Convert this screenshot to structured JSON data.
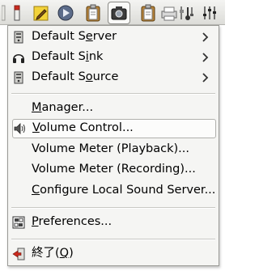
{
  "panel": {
    "icons": [
      "panel-handle-icon",
      "notes-icon",
      "media-player-icon",
      "clipboard-icon",
      "screenshot-icon",
      "clipboard-icon",
      "printer-icon",
      "audio-settings-icon",
      "volume-mixer-icon"
    ]
  },
  "menu": {
    "default_server": {
      "pre": "Default S",
      "key": "e",
      "post": "rver"
    },
    "default_sink": {
      "pre": "Default S",
      "key": "i",
      "post": "nk"
    },
    "default_source": {
      "pre": "Default S",
      "key": "o",
      "post": "urce"
    },
    "manager": {
      "pre": "",
      "key": "M",
      "post": "anager..."
    },
    "volume_control": {
      "pre": "",
      "key": "V",
      "post": "olume Control..."
    },
    "volume_meter_playback": {
      "pre": "Volume Meter (Playback)...",
      "key": "",
      "post": ""
    },
    "volume_meter_recording": {
      "pre": "Volume Meter (Recording)...",
      "key": "",
      "post": ""
    },
    "configure_local": {
      "pre": "",
      "key": "C",
      "post": "onfigure Local Sound Server..."
    },
    "preferences": {
      "pre": "",
      "key": "P",
      "post": "references..."
    },
    "quit": {
      "pre": "終了(",
      "key": "Q",
      "post": ")"
    }
  },
  "colors": {
    "accent_red": "#cc2a1e",
    "folder_yellow": "#e8c547",
    "blue": "#3a6ea5"
  }
}
